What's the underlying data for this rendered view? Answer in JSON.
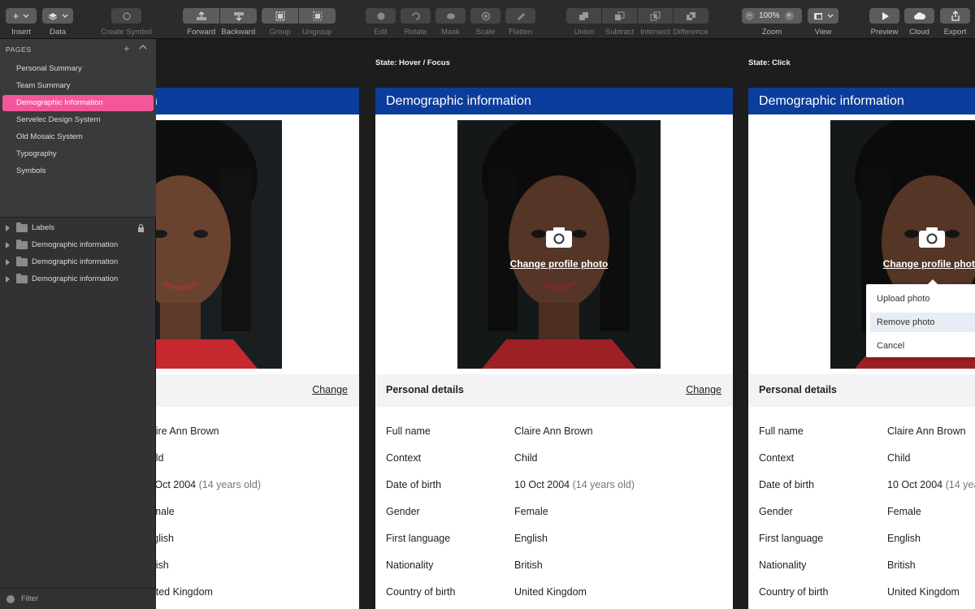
{
  "toolbar": {
    "insert": "Insert",
    "data": "Data",
    "create_symbol": "Create Symbol",
    "forward": "Forward",
    "backward": "Backward",
    "group": "Group",
    "ungroup": "Ungroup",
    "edit": "Edit",
    "rotate": "Rotate",
    "mask": "Mask",
    "scale": "Scale",
    "flatten": "Flatten",
    "union": "Union",
    "subtract": "Subtract",
    "intersect": "Intersect",
    "difference": "Difference",
    "zoom_label": "Zoom",
    "zoom_value": "100%",
    "view": "View",
    "preview": "Preview",
    "cloud": "Cloud",
    "export": "Export"
  },
  "sidebar": {
    "pages_title": "PAGES",
    "pages": [
      {
        "label": "Personal Summary"
      },
      {
        "label": "Team Summary"
      },
      {
        "label": "Demographic Information"
      },
      {
        "label": "Servelec Design System"
      },
      {
        "label": "Old Mosaic System"
      },
      {
        "label": "Typography"
      },
      {
        "label": "Symbols"
      }
    ],
    "active_page": 2,
    "layers": [
      {
        "label": "Labels",
        "locked": true
      },
      {
        "label": "Demographic information",
        "locked": false
      },
      {
        "label": "Demographic information",
        "locked": false
      },
      {
        "label": "Demographic information",
        "locked": false
      }
    ],
    "filter_placeholder": "Filter"
  },
  "canvas": {
    "states": [
      "State: Hover / Focus",
      "State: Click"
    ],
    "card": {
      "title": "Demographic information",
      "change_photo": "Change profile photo",
      "section_title": "Personal details",
      "section_link": "Change",
      "rows": [
        {
          "label": "Full name",
          "value": "Claire Ann Brown",
          "extra": ""
        },
        {
          "label": "Context",
          "value": "Child",
          "extra": ""
        },
        {
          "label": "Date of birth",
          "value": "10 Oct 2004",
          "extra": "(14 years old)"
        },
        {
          "label": "Gender",
          "value": "Female",
          "extra": ""
        },
        {
          "label": "First language",
          "value": "English",
          "extra": ""
        },
        {
          "label": "Nationality",
          "value": "British",
          "extra": ""
        },
        {
          "label": "Country of birth",
          "value": "United Kingdom",
          "extra": ""
        }
      ]
    },
    "menu": {
      "items": [
        "Upload photo",
        "Remove photo",
        "Cancel"
      ],
      "highlighted": 1
    },
    "colors": {
      "header_blue": "#0b3d9c",
      "active_page_pink": "#f4569b"
    }
  }
}
